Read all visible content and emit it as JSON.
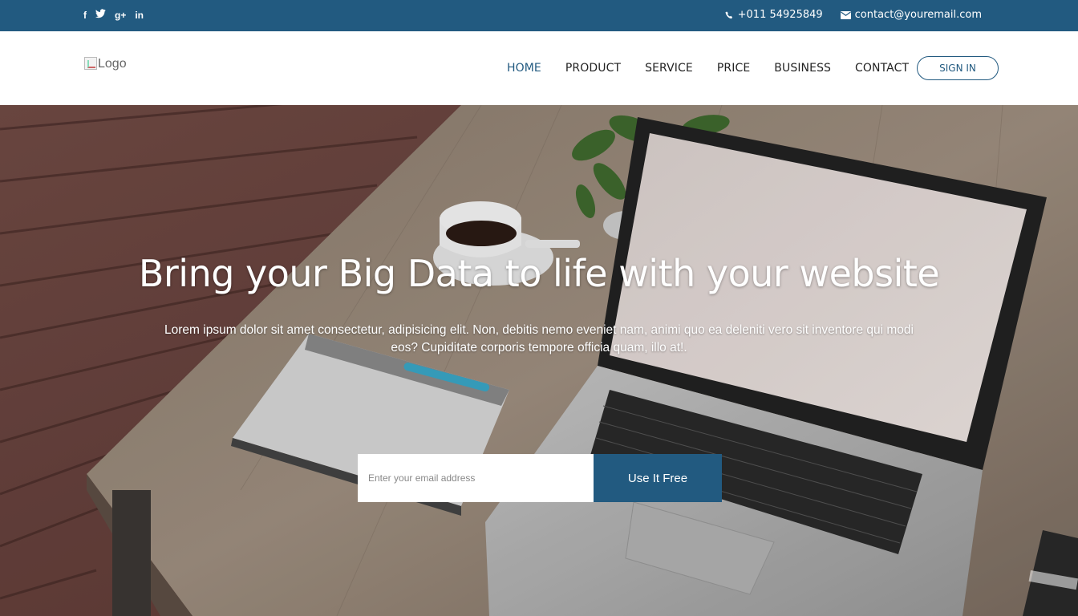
{
  "topbar": {
    "social": [
      {
        "icon": "facebook-icon",
        "glyph": "f"
      },
      {
        "icon": "twitter-icon",
        "glyph": "t"
      },
      {
        "icon": "google-plus-icon",
        "glyph": "g+"
      },
      {
        "icon": "linkedin-icon",
        "glyph": "in"
      }
    ],
    "phone": "+011 54925849",
    "email": "contact@youremail.com",
    "colors": {
      "background": "#225a80"
    }
  },
  "header": {
    "logo_alt": "Logo",
    "nav": [
      {
        "label": "HOME",
        "active": true
      },
      {
        "label": "PRODUCT"
      },
      {
        "label": "SERVICE"
      },
      {
        "label": "PRICE"
      },
      {
        "label": "BUSINESS"
      },
      {
        "label": "CONTACT"
      }
    ],
    "signin_label": "SIGN IN",
    "colors": {
      "accent": "#225a80"
    }
  },
  "hero": {
    "title": "Bring your Big Data to life with your website",
    "text": "Lorem ipsum dolor sit amet consectetur, adipisicing elit. Non, debitis nemo eveniet nam, animi quo ea deleniti vero sit inventore qui modi eos? Cupiditate corporis tempore officia quam, illo at!.",
    "email_placeholder": "Enter your email address",
    "cta_label": "Use It Free"
  }
}
